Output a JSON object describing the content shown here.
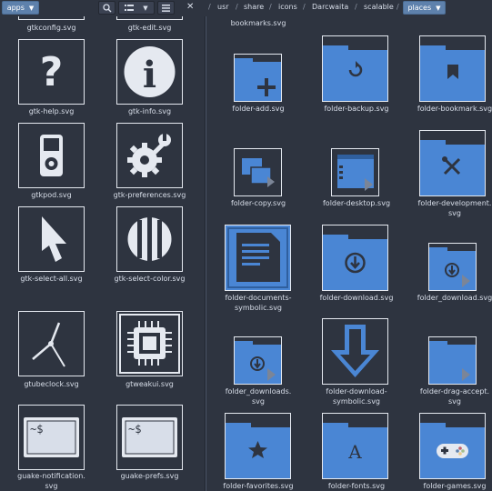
{
  "toolbar": {
    "location_label": "apps",
    "breadcrumbs": [
      "usr",
      "share",
      "icons",
      "Darcwaita",
      "scalable"
    ],
    "current_crumb": "places"
  },
  "left_files": [
    {
      "name": "gtkconfig.svg"
    },
    {
      "name": "gtk-edit.svg"
    },
    {
      "name": "gtk-help.svg"
    },
    {
      "name": "gtk-info.svg"
    },
    {
      "name": "gtkpod.svg"
    },
    {
      "name": "gtk-preferences.svg"
    },
    {
      "name": "gtk-select-all.svg"
    },
    {
      "name": "gtk-select-color.svg"
    },
    {
      "name": "gtubeclock.svg"
    },
    {
      "name": "gtweakui.svg"
    },
    {
      "name_l1": "guake-notification.",
      "name_l2": "svg"
    },
    {
      "name": "guake-prefs.svg"
    }
  ],
  "right_files": [
    {
      "name": "bookmarks.svg"
    },
    {
      "name": "folder-add.svg"
    },
    {
      "name": "folder-backup.svg"
    },
    {
      "name": "folder-bookmark.svg"
    },
    {
      "name": "folder-copy.svg"
    },
    {
      "name": "folder-desktop.svg"
    },
    {
      "name_l1": "folder-development.",
      "name_l2": "svg"
    },
    {
      "name_l1": "folder-documents-",
      "name_l2": "symbolic.svg"
    },
    {
      "name": "folder-download.svg"
    },
    {
      "name": "folder_download.svg"
    },
    {
      "name_l1": "folder_downloads.",
      "name_l2": "svg"
    },
    {
      "name_l1": "folder-download-",
      "name_l2": "symbolic.svg"
    },
    {
      "name_l1": "folder-drag-accept.",
      "name_l2": "svg"
    },
    {
      "name": "folder-favorites.svg"
    },
    {
      "name": "folder-fonts.svg"
    },
    {
      "name": "folder-games.svg"
    }
  ],
  "terminal_prompt": "~$",
  "font_glyph": "A",
  "colors": {
    "bg": "#2e3440",
    "accent": "#5e81ac",
    "folder": "#4a86d4",
    "folder_dark": "#2f5f9e"
  }
}
